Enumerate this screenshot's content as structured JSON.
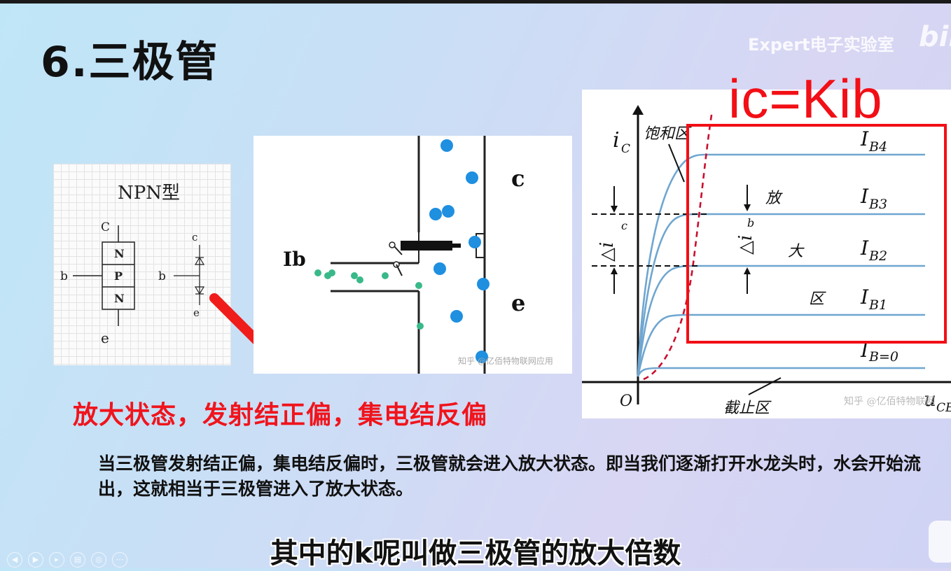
{
  "slide": {
    "title": "6.三极管",
    "watermark": "Expert电子实验室",
    "bili_logo": "bili"
  },
  "npn_figure": {
    "caption": "NPN型",
    "labels": {
      "c_big": "C",
      "c_small": "c",
      "b_left": "b",
      "b_right": "b",
      "e_big": "e",
      "e_small": "e"
    },
    "layers": [
      "N",
      "P",
      "N"
    ]
  },
  "flow_figure": {
    "ib_label": "Ib",
    "c_label": "c",
    "e_label": "e",
    "watermark": "知乎 @亿佰特物联网应用"
  },
  "curve_figure": {
    "y_axis": "i",
    "y_axis_sub": "C",
    "x_axis": "u",
    "x_axis_sub": "CE",
    "origin": "O",
    "saturation_label": "饱和区",
    "cutoff_label": "截止区",
    "delta_ic": "△i",
    "delta_ic_sub": "c",
    "delta_ib": "△i",
    "delta_ib_sub": "b",
    "region_chars": [
      "放",
      "大",
      "区"
    ],
    "curve_labels": [
      {
        "main": "I",
        "sub": "B4"
      },
      {
        "main": "I",
        "sub": "B3"
      },
      {
        "main": "I",
        "sub": "B2"
      },
      {
        "main": "I",
        "sub": "B1"
      },
      {
        "main": "I",
        "sub": "B=0"
      }
    ],
    "watermark": "知乎 @亿佰特物联网"
  },
  "formula": "ic=Kib",
  "red_caption": "放大状态，发射结正偏，集电结反偏",
  "description": "当三极管发射结正偏，集电结反偏时，三极管就会进入放大状态。即当我们逐渐打开水龙头时，水会开始流出，这就相当于三极管进入了放大状态。",
  "subtitle": "其中的k呢叫做三极管的放大倍数",
  "player_controls": [
    "prev-icon",
    "play-icon",
    "next-icon",
    "settings-icon",
    "zoom-icon",
    "fullscreen-icon"
  ],
  "colors": {
    "accent_red": "#f20f16",
    "curve_blue": "#6fa6d0",
    "dot_blue": "#1f8fe0",
    "dot_green": "#39b98a"
  }
}
